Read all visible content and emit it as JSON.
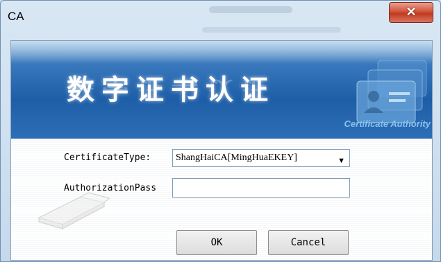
{
  "window": {
    "title": "CA",
    "close_glyph": "✕"
  },
  "banner": {
    "title": "数字证书认证",
    "subtitle": "Certificate Authority",
    "graphic": "certificate-cards-icon"
  },
  "form": {
    "certificate_type_label": "CertificateType:",
    "certificate_type_value": "ShangHaiCA[MingHuaEKEY]",
    "authorization_pass_label": "AuthorizationPass",
    "authorization_pass_value": "",
    "ok_label": "OK",
    "cancel_label": "Cancel",
    "decoration": "usb-key-icon"
  },
  "colors": {
    "banner_blue": "#1e5ea7",
    "close_red": "#c13a20",
    "field_border": "#7f9db9"
  }
}
